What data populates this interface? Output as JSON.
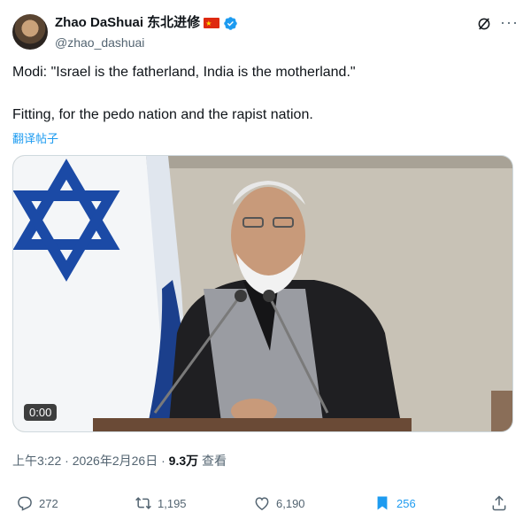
{
  "user": {
    "display_name": "Zhao DaShuai 东北进修",
    "handle": "@zhao_dashuai",
    "verified_color": "#1d9bf0"
  },
  "icons": [
    "grok-icon",
    "more-icon",
    "verified-icon",
    "reply-icon",
    "retweet-icon",
    "like-icon",
    "bookmark-icon",
    "share-icon"
  ],
  "tweet": {
    "line1": "Modi: \"Israel is the fatherland, India is the motherland.\"",
    "line2": "Fitting, for the pedo nation and the rapist nation.",
    "translate_label": "翻译帖子"
  },
  "media": {
    "video_time": "0:00"
  },
  "meta": {
    "time": "上午3:22",
    "date": "2026年2月26日",
    "views_count": "9.3万",
    "views_label": "查看"
  },
  "actions": {
    "replies": "272",
    "retweets": "1,195",
    "likes": "6,190",
    "bookmarks": "256"
  },
  "colors": {
    "accent": "#1d9bf0",
    "text": "#0f1419",
    "muted": "#536471"
  }
}
